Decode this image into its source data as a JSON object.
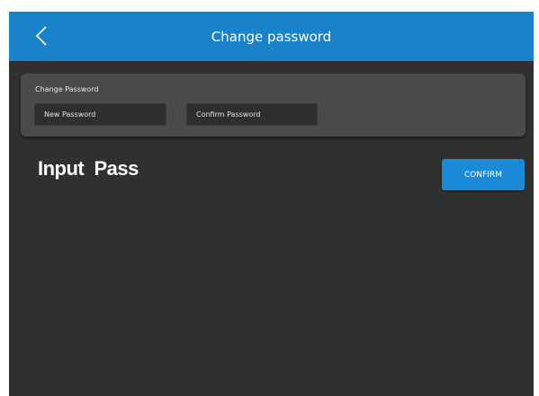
{
  "colors": {
    "header_bg": "#1a82c8",
    "screen_bg": "#303030",
    "panel_bg": "#4a4a4a",
    "accent": "#1a8ad6",
    "text": "#ffffff"
  },
  "header": {
    "title": "Change password",
    "back_icon": "chevron-left-icon"
  },
  "panel": {
    "label": "Change Password",
    "new_password_placeholder": "New Password",
    "new_password_value": "",
    "confirm_password_placeholder": "Confirm Password",
    "confirm_password_value": ""
  },
  "main": {
    "status_text": "Input  Pass",
    "confirm_label": "CONFIRM"
  }
}
